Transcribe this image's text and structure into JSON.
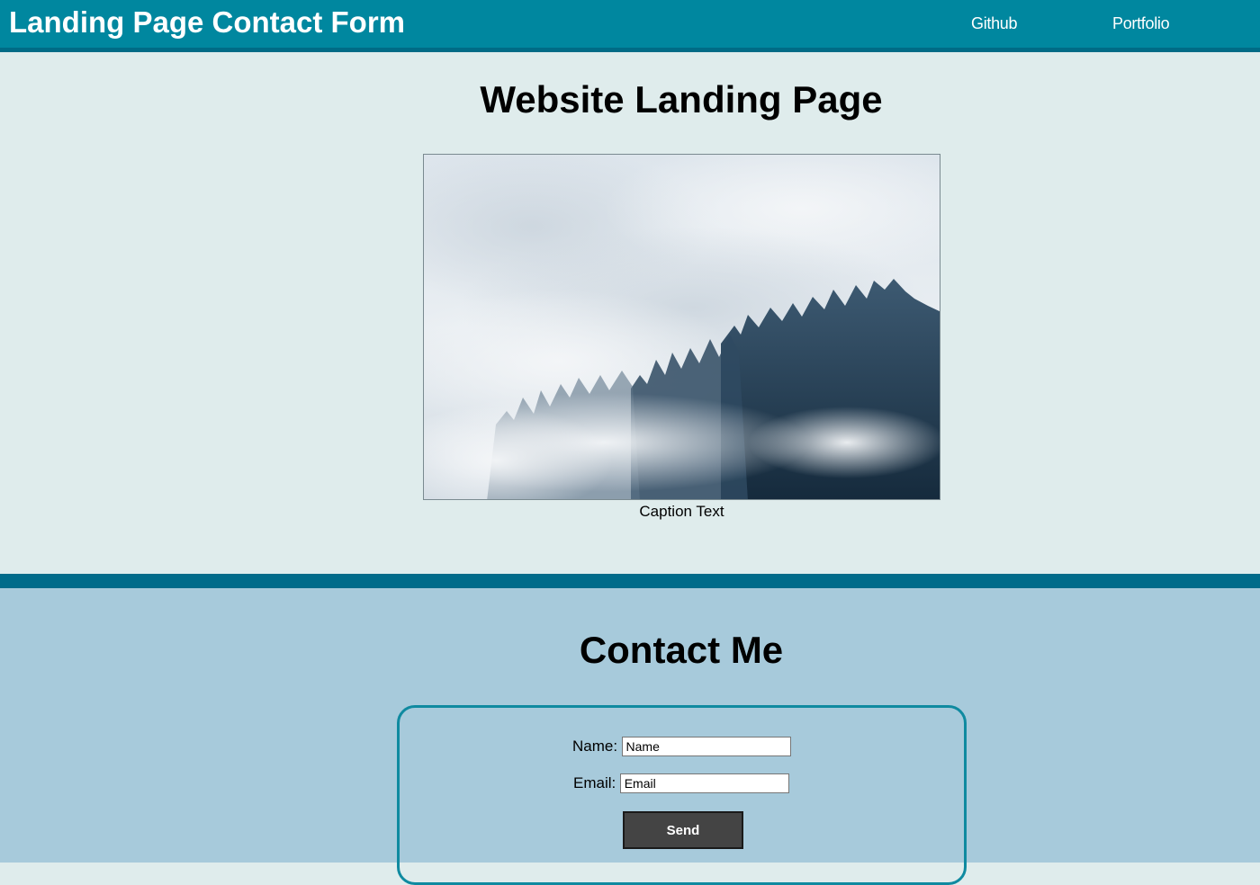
{
  "header": {
    "title": "Landing Page Contact Form",
    "nav": [
      {
        "label": "Github"
      },
      {
        "label": "Portfolio"
      }
    ]
  },
  "hero": {
    "title": "Website Landing Page",
    "image_description": "misty forest",
    "caption": "Caption Text"
  },
  "contact": {
    "title": "Contact Me",
    "name_label": "Name:",
    "name_value": "Name",
    "email_label": "Email:",
    "email_value": "Email",
    "send_label": "Send"
  },
  "colors": {
    "header_bg": "#00879f",
    "hero_bg": "#dfecec",
    "divider": "#006b8a",
    "contact_bg": "#a7cadb",
    "form_border": "#0f8aa0",
    "button_bg": "#444444"
  }
}
